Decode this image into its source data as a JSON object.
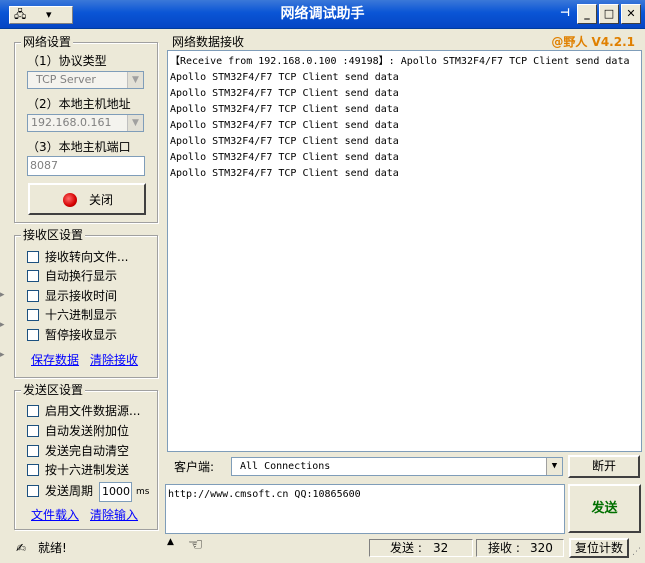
{
  "window": {
    "title": "网络调试助手"
  },
  "brand": "@野人 V4.2.1",
  "net_settings": {
    "legend": "网络设置",
    "protocol_label": "（1）协议类型",
    "protocol_value": "TCP Server",
    "host_label": "（2）本地主机地址",
    "host_value": "192.168.0.161",
    "port_label": "（3）本地主机端口",
    "port_value": "8087",
    "close_button": "关闭"
  },
  "recv_settings": {
    "legend": "接收区设置",
    "options": [
      "接收转向文件...",
      "自动换行显示",
      "显示接收时间",
      "十六进制显示",
      "暂停接收显示"
    ],
    "save_link": "保存数据",
    "clear_link": "清除接收"
  },
  "send_settings": {
    "legend": "发送区设置",
    "options": [
      "启用文件数据源...",
      "自动发送附加位",
      "发送完自动清空",
      "按十六进制发送"
    ],
    "period_label": "发送周期",
    "period_value": "1000",
    "period_unit": "ms",
    "load_link": "文件载入",
    "clear_link": "清除输入"
  },
  "receive": {
    "legend": "网络数据接收",
    "lines": [
      "【Receive from 192.168.0.100 :49198】: Apollo STM32F4/F7 TCP Client send data",
      "Apollo STM32F4/F7 TCP Client send data",
      "Apollo STM32F4/F7 TCP Client send data",
      "Apollo STM32F4/F7 TCP Client send data",
      "Apollo STM32F4/F7 TCP Client send data",
      "Apollo STM32F4/F7 TCP Client send data",
      "Apollo STM32F4/F7 TCP Client send data",
      "Apollo STM32F4/F7 TCP Client send data"
    ]
  },
  "client": {
    "label": "客户端:",
    "selected": "All Connections",
    "disconnect_button": "断开"
  },
  "send": {
    "text": "http://www.cmsoft.cn QQ:10865600",
    "send_button": "发送"
  },
  "status": {
    "text": "就绪!",
    "sent_label": "发送 :",
    "sent_count": "32",
    "recv_label": "接收 :",
    "recv_count": "320",
    "reset_button": "复位计数"
  }
}
